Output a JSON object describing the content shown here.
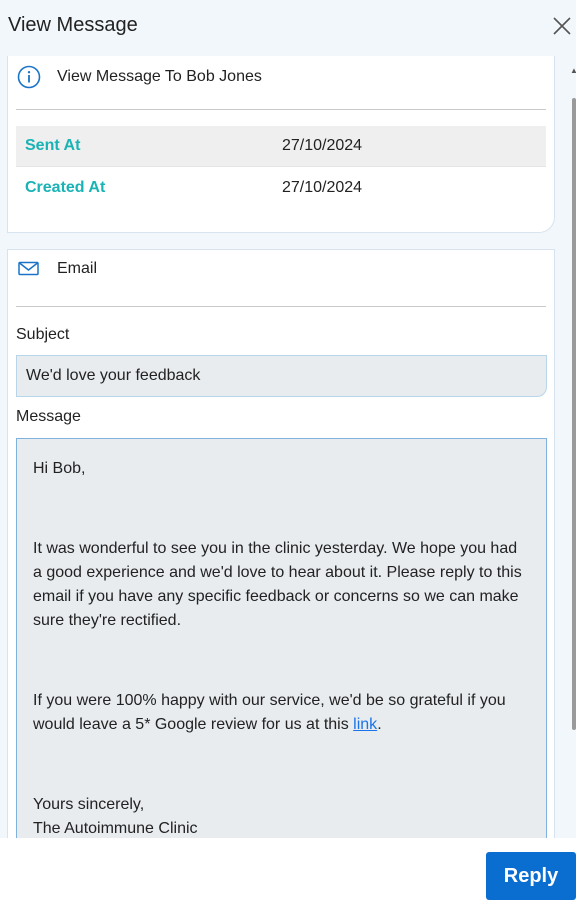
{
  "window": {
    "title": "View Message"
  },
  "info_card": {
    "heading": "View Message To Bob Jones",
    "rows": [
      {
        "label": "Sent At",
        "value": "27/10/2024"
      },
      {
        "label": "Created At",
        "value": "27/10/2024"
      }
    ]
  },
  "email_card": {
    "heading": "Email",
    "subject_label": "Subject",
    "subject_value": "We'd love your feedback",
    "message_label": "Message",
    "message": {
      "greeting": "Hi Bob,",
      "para1": "It was wonderful to see you in the clinic yesterday. We hope you had a good experience and we'd love to hear about it. Please reply to this email if you have any specific feedback or concerns so we can make sure they're rectified.",
      "para2_before_link": "If you were 100% happy with our service, we'd be so grateful if you would leave a 5* Google review for us at this ",
      "link_text": "link",
      "para2_after_link": ".",
      "signoff": "Yours sincerely,",
      "signature": "The Autoimmune Clinic"
    }
  },
  "footer": {
    "reply_label": "Reply"
  },
  "colors": {
    "accent": "#0a6ed1",
    "label_teal": "#19b3b5",
    "field_bg": "#e8ecef"
  },
  "icons": {
    "info": "info-icon",
    "email": "mail-icon",
    "close": "close-icon"
  }
}
